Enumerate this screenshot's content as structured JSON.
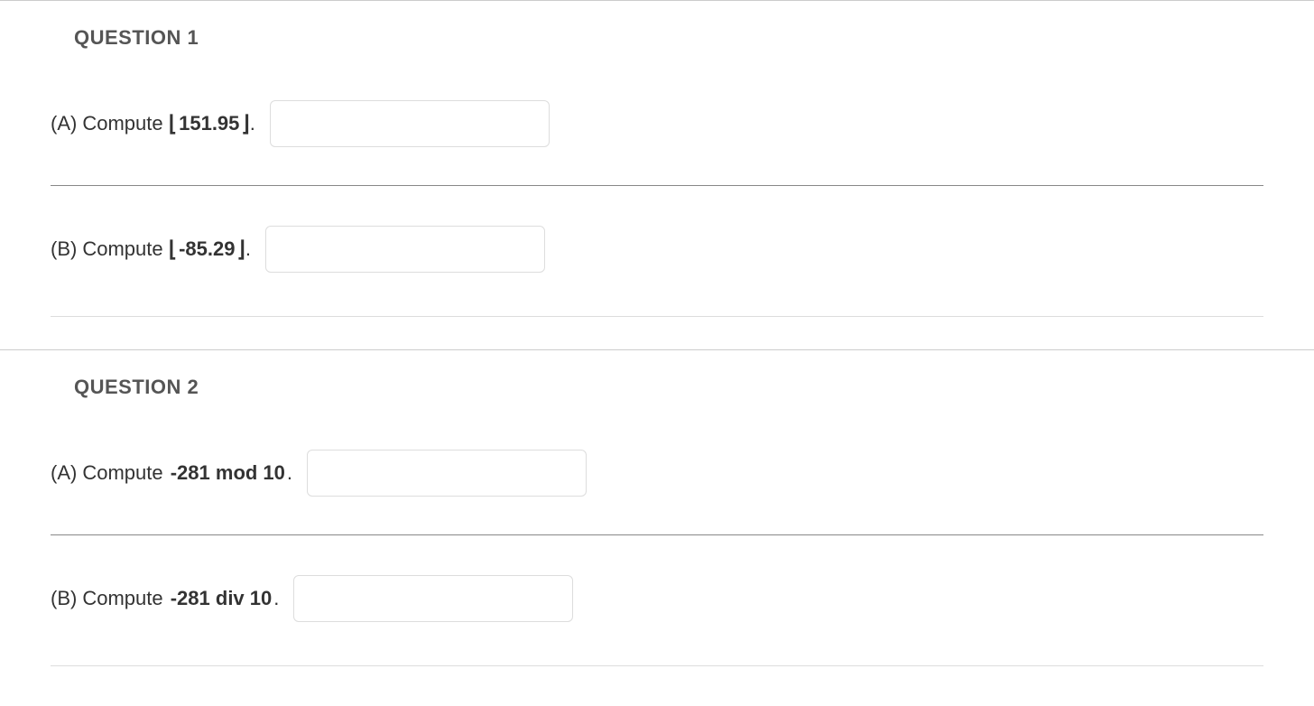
{
  "questions": [
    {
      "title": "QUESTION 1",
      "parts": [
        {
          "label": "(A)",
          "prompt": "Compute",
          "expression_prefix": "⌊",
          "expression": "151.95",
          "expression_suffix": "⌋",
          "period": "."
        },
        {
          "label": "(B)",
          "prompt": "Compute",
          "expression_prefix": "⌊",
          "expression": "-85.29",
          "expression_suffix": "⌋",
          "period": "."
        }
      ]
    },
    {
      "title": "QUESTION 2",
      "parts": [
        {
          "label": "(A)",
          "prompt": "Compute",
          "expression_prefix": "",
          "expression": "-281 mod 10",
          "expression_suffix": "",
          "period": "."
        },
        {
          "label": "(B)",
          "prompt": "Compute",
          "expression_prefix": "",
          "expression": "-281 div 10",
          "expression_suffix": "",
          "period": "."
        }
      ]
    }
  ]
}
